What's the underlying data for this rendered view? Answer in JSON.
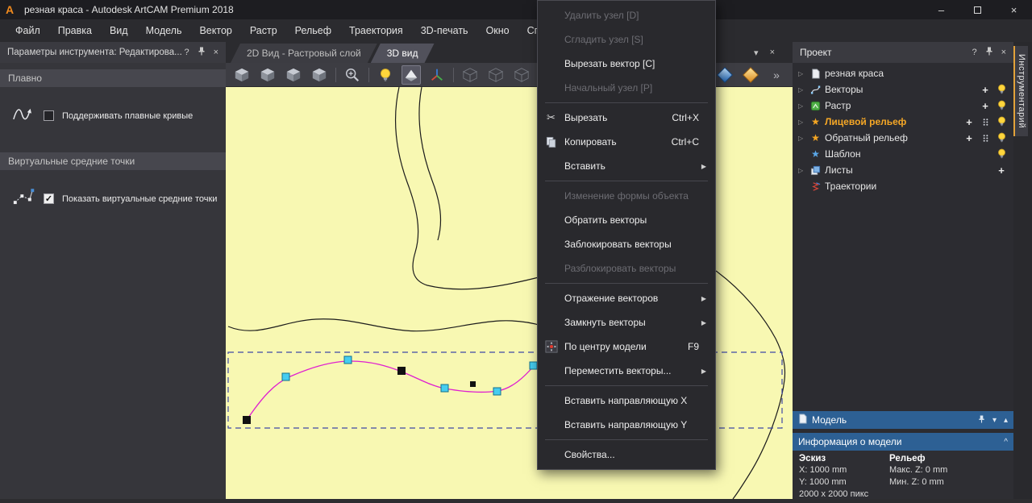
{
  "titlebar": {
    "title": "резная краса - Autodesk ArtCAM Premium 2018"
  },
  "menubar": [
    "Файл",
    "Правка",
    "Вид",
    "Модель",
    "Вектор",
    "Растр",
    "Рельеф",
    "Траектория",
    "3D-печать",
    "Окно",
    "Справка"
  ],
  "tool_panel": {
    "title": "Параметры инструмента: Редактирова...",
    "sections": [
      {
        "title": "Плавно",
        "icon": "smooth-curve-icon",
        "checked": false,
        "label": "Поддерживать плавные кривые"
      },
      {
        "title": "Виртуальные средние точки",
        "icon": "midpoints-icon",
        "checked": true,
        "label": "Показать виртуальные средние точки"
      }
    ]
  },
  "view_tabs": [
    {
      "label": "2D Вид - Растровый слой",
      "active": false
    },
    {
      "label": "3D вид",
      "active": true
    }
  ],
  "toolbar": {
    "left": [
      {
        "type": "cube",
        "name": "view-iso-icon"
      },
      {
        "type": "cube",
        "name": "view-top-icon"
      },
      {
        "type": "cube",
        "name": "view-front-icon"
      },
      {
        "type": "cube",
        "name": "view-side-icon"
      },
      {
        "type": "sep"
      },
      {
        "type": "zoom",
        "name": "zoom-to-fit-icon"
      },
      {
        "type": "sep"
      },
      {
        "type": "bulb",
        "name": "lighting-icon"
      },
      {
        "type": "shade",
        "name": "shading-mode-icon",
        "pressed": true
      },
      {
        "type": "axes",
        "name": "origin-axes-icon"
      },
      {
        "type": "sep"
      },
      {
        "type": "graycube",
        "name": "view-option-disabled-1-icon"
      },
      {
        "type": "graycube",
        "name": "view-option-disabled-2-icon"
      },
      {
        "type": "graycube",
        "name": "view-option-disabled-3-icon"
      },
      {
        "type": "graycube",
        "name": "view-option-disabled-4-icon"
      }
    ],
    "right": [
      {
        "type": "mat-blue",
        "name": "material-blue-icon"
      },
      {
        "type": "mat-gold",
        "name": "material-gold-icon"
      },
      {
        "type": "overflow",
        "name": "toolbar-overflow-icon"
      }
    ]
  },
  "context_menu": {
    "items": [
      {
        "label": "Удалить узел  [D]",
        "disabled": true
      },
      {
        "label": "Сгладить узел  [S]",
        "disabled": true
      },
      {
        "label": "Вырезать вектор [C]"
      },
      {
        "label": "Начальный узел  [P]",
        "disabled": true
      },
      {
        "sep": true
      },
      {
        "label": "Вырезать",
        "shortcut": "Ctrl+X",
        "icon": "scissors-icon"
      },
      {
        "label": "Копировать",
        "shortcut": "Ctrl+C",
        "icon": "copy-icon"
      },
      {
        "label": "Вставить",
        "submenu": true
      },
      {
        "sep": true
      },
      {
        "label": "Изменение формы объекта",
        "disabled": true
      },
      {
        "label": "Обратить векторы"
      },
      {
        "label": "Заблокировать векторы"
      },
      {
        "label": "Разблокировать векторы",
        "disabled": true
      },
      {
        "sep": true
      },
      {
        "label": "Отражение векторов",
        "submenu": true
      },
      {
        "label": "Замкнуть векторы",
        "submenu": true
      },
      {
        "label": "По центру модели",
        "shortcut": "F9",
        "icon": "center-model-icon"
      },
      {
        "label": "Переместить векторы...",
        "submenu": true
      },
      {
        "sep": true
      },
      {
        "label": "Вставить направляющую X"
      },
      {
        "label": "Вставить направляющую Y"
      },
      {
        "sep": true
      },
      {
        "label": "Свойства..."
      }
    ]
  },
  "project_panel": {
    "title": "Проект",
    "tree": [
      {
        "label": "резная краса",
        "icon": "document-icon",
        "arrow": true,
        "controls": []
      },
      {
        "label": "Векторы",
        "icon": "vectors-icon",
        "arrow": true,
        "controls": [
          "plus",
          "bulb"
        ]
      },
      {
        "label": "Растр",
        "icon": "raster-icon",
        "arrow": true,
        "controls": [
          "plus",
          "bulb"
        ]
      },
      {
        "label": "Лицевой рельеф",
        "icon": "relief-star-icon",
        "arrow": true,
        "highlight": true,
        "controls": [
          "plus",
          "grid",
          "bulb"
        ]
      },
      {
        "label": "Обратный рельеф",
        "icon": "relief-star-icon",
        "arrow": true,
        "controls": [
          "plus",
          "grid",
          "bulb"
        ]
      },
      {
        "label": "Шаблон",
        "icon": "template-star-icon",
        "arrow": false,
        "controls": [
          "bulb"
        ]
      },
      {
        "label": "Листы",
        "icon": "sheets-icon",
        "arrow": true,
        "controls": [
          "plus"
        ]
      },
      {
        "label": "Траектории",
        "icon": "toolpaths-icon",
        "arrow": false,
        "controls": []
      }
    ]
  },
  "model_bar": {
    "title": "Модель"
  },
  "model_info": {
    "title": "Информация о модели",
    "columns": [
      {
        "header": "Эскиз",
        "rows": [
          "X: 1000 mm",
          "Y: 1000 mm",
          "2000 x 2000 пикс"
        ]
      },
      {
        "header": "Рельеф",
        "rows": [
          "Макс. Z: 0 mm",
          "Мин. Z: 0 mm"
        ]
      }
    ]
  },
  "right_strip": {
    "tab": "Инструментарий"
  },
  "icons": {
    "artcam-logo-icon": "A",
    "minimize-icon": "–",
    "close-icon": "×",
    "help-icon": "?",
    "expander-icon": "▷",
    "submenu-arrow-icon": "▶",
    "triangle-down-icon": "▾",
    "triangle-up-icon": "▴",
    "collapse-icon": "^",
    "plus-icon": "+",
    "star-icon": "★",
    "scissors-icon": "✂",
    "overflow-icon": "»",
    "check-icon": "✓"
  },
  "colors": {
    "canvas": "#f8f8b2",
    "accent_orange": "#f5a726",
    "header_blue": "#2d6094",
    "selection_magenta": "#df1fd0",
    "handle_cyan": "#46cdf0",
    "selection_dash_blue": "#3f49a6"
  }
}
